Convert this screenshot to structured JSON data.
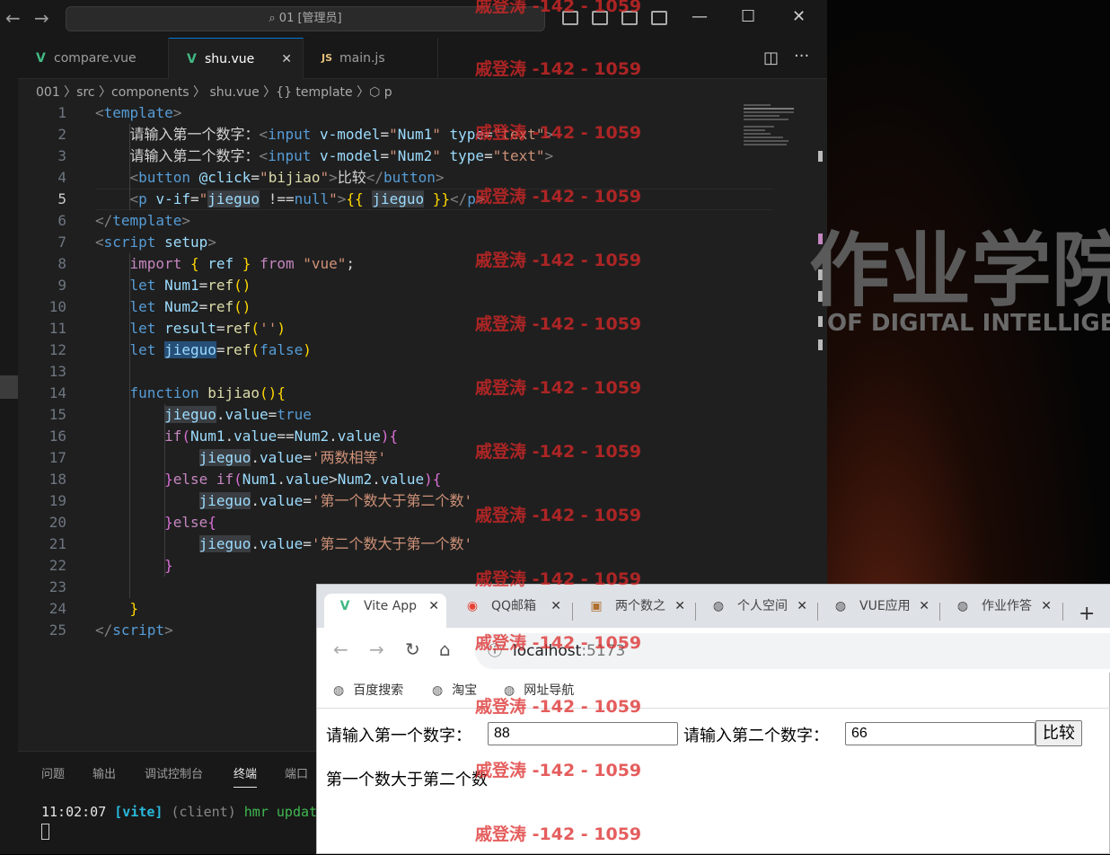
{
  "titlebar": {
    "search": "01 [管理员]",
    "back": "←",
    "forward": "→"
  },
  "window_controls": {
    "minimize": "—",
    "maximize": "☐",
    "close": "✕"
  },
  "editor_tabs": [
    {
      "label": "compare.vue",
      "icon": "V"
    },
    {
      "label": "shu.vue",
      "icon": "V",
      "close": "✕"
    },
    {
      "label": "main.js",
      "icon": "JS"
    }
  ],
  "breadcrumb": "001 〉src 〉components 〉 shu.vue 〉{} template 〉⬡ p",
  "line_numbers": [
    "1",
    "2",
    "3",
    "4",
    "5",
    "6",
    "7",
    "8",
    "9",
    "10",
    "11",
    "12",
    "13",
    "14",
    "15",
    "16",
    "17",
    "18",
    "19",
    "20",
    "21",
    "22",
    "23",
    "24",
    "25"
  ],
  "code": {
    "l2_label": "请输入第一个数字：",
    "l3_label": "请输入第二个数字：",
    "l4_text": "比较",
    "l17_str": "'两数相等'",
    "l19_str": "'第一个数大于第二个数'",
    "l21_str": "'第二个数大于第一个数'"
  },
  "panel": {
    "tabs": [
      "问题",
      "输出",
      "调试控制台",
      "终端",
      "端口"
    ],
    "term_time": "11:02:07",
    "term_tag": "[vite]",
    "term_client": "(client)",
    "term_msg": "hmr updat"
  },
  "background": {
    "title": "作业学院",
    "subtitle": "OF DIGITAL INTELLIGEN"
  },
  "browser": {
    "tabs": [
      "Vite App",
      "QQ邮箱",
      "两个数之",
      "个人空间",
      "VUE应用",
      "作业作答"
    ],
    "new_tab": "+",
    "url_host": "localhost",
    "url_port": ":5173",
    "bookmarks": [
      "百度搜索",
      "淘宝",
      "网址导航"
    ],
    "label1": "请输入第一个数字：",
    "value1": "88",
    "label2": "请输入第二个数字：",
    "value2": "66",
    "button": "比较",
    "result": "第一个数大于第二个数"
  },
  "watermark": "戚登涛 -142 - 1059"
}
